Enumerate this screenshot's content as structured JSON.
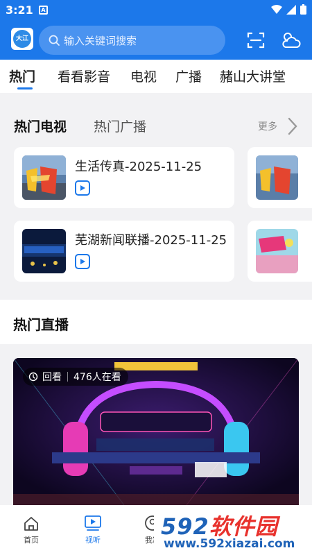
{
  "status_bar": {
    "time": "3:21",
    "app_badge": "A"
  },
  "header": {
    "logo_text": "大江",
    "search_placeholder": "输入关键词搜索"
  },
  "category_tabs": [
    {
      "label": "热门",
      "active": true
    },
    {
      "label": "看看影音",
      "active": false
    },
    {
      "label": "电视",
      "active": false
    },
    {
      "label": "广播",
      "active": false
    },
    {
      "label": "赭山大讲堂",
      "active": false
    }
  ],
  "hot_section": {
    "tabs": [
      {
        "label": "热门电视",
        "active": true
      },
      {
        "label": "热门广播",
        "active": false
      }
    ],
    "more_label": "更多",
    "items": [
      {
        "title": "生活传真-2025-11-25"
      },
      {
        "title": "芜湖新闻联播-2025-11-25"
      }
    ]
  },
  "live_section": {
    "heading": "热门直播",
    "badge_replay": "回看",
    "badge_viewers": "476人在看"
  },
  "bottom_nav": [
    {
      "label": "首页",
      "icon": "home-icon",
      "active": false
    },
    {
      "label": "视听",
      "icon": "video-icon",
      "active": true
    },
    {
      "label": "我家",
      "icon": "user-icon",
      "active": false
    }
  ],
  "watermark": {
    "text_left": "592",
    "text_right": "软件园",
    "url": "www.592xiazai.com"
  },
  "colors": {
    "primary": "#1c78ea",
    "background": "#f2f2f4"
  }
}
